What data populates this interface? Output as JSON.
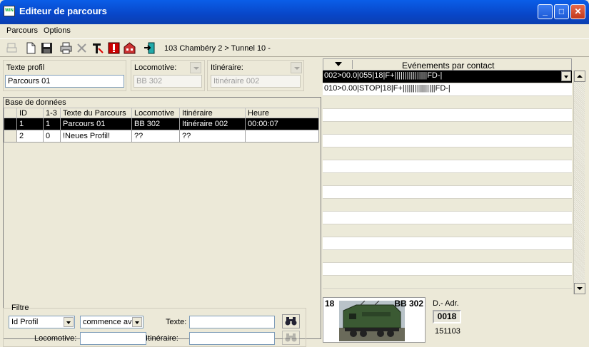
{
  "window": {
    "title": "Editeur de parcours",
    "icon_text": "WIN"
  },
  "menu": {
    "parcours": "Parcours",
    "options": "Options"
  },
  "toolbar": {
    "route": "103 Chambéry 2 > Tunnel 10 -"
  },
  "profile": {
    "texte_label": "Texte profil",
    "texte_value": "Parcours 01",
    "loco_label": "Locomotive:",
    "loco_value": "BB 302",
    "itin_label": "Itinéraire:",
    "itin_value": "Itinéraire 002"
  },
  "database": {
    "title": "Base de données",
    "columns": [
      "ID",
      "1-3",
      "Texte du Parcours",
      "Locomotive",
      "Itinéraire",
      "Heure"
    ],
    "rows": [
      [
        "1",
        "1",
        "Parcours 01",
        "BB 302",
        "Itinéraire 002",
        "00:00:07"
      ],
      [
        "2",
        "0",
        "!Neues Profil!",
        "??",
        "??",
        ""
      ]
    ]
  },
  "filter": {
    "title": "Filtre",
    "field_value": "Id Profil",
    "mode_value": "commence av",
    "texte_label": "Texte:",
    "loco_label": "Locomotive:",
    "itin_label": "Itinéraire:"
  },
  "events": {
    "title": "Evénements par contact",
    "rows": [
      "002>00.0|055|18|F+||||||||||||||||FD-|",
      "010>0.00|STOP|18|F+||||||||||||||||FD-|"
    ]
  },
  "loco_card": {
    "number": "18",
    "name": "BB 302",
    "dadr_label": "D.- Adr.",
    "dadr_value": "0018",
    "serial": "151103"
  },
  "icons": [
    "print-preview-icon",
    "new-icon",
    "save-icon",
    "print-icon",
    "delete-icon",
    "text-t-icon",
    "warning-icon",
    "station-icon",
    "exit-icon",
    "binoculars-icon"
  ]
}
